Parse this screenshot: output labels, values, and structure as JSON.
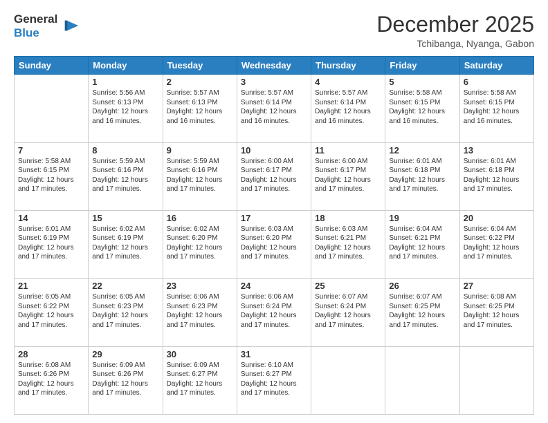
{
  "logo": {
    "general": "General",
    "blue": "Blue"
  },
  "header": {
    "month": "December 2025",
    "location": "Tchibanga, Nyanga, Gabon"
  },
  "weekdays": [
    "Sunday",
    "Monday",
    "Tuesday",
    "Wednesday",
    "Thursday",
    "Friday",
    "Saturday"
  ],
  "weeks": [
    [
      {
        "day": "",
        "sunrise": "",
        "sunset": "",
        "daylight": ""
      },
      {
        "day": "1",
        "sunrise": "Sunrise: 5:56 AM",
        "sunset": "Sunset: 6:13 PM",
        "daylight": "Daylight: 12 hours and 16 minutes."
      },
      {
        "day": "2",
        "sunrise": "Sunrise: 5:57 AM",
        "sunset": "Sunset: 6:13 PM",
        "daylight": "Daylight: 12 hours and 16 minutes."
      },
      {
        "day": "3",
        "sunrise": "Sunrise: 5:57 AM",
        "sunset": "Sunset: 6:14 PM",
        "daylight": "Daylight: 12 hours and 16 minutes."
      },
      {
        "day": "4",
        "sunrise": "Sunrise: 5:57 AM",
        "sunset": "Sunset: 6:14 PM",
        "daylight": "Daylight: 12 hours and 16 minutes."
      },
      {
        "day": "5",
        "sunrise": "Sunrise: 5:58 AM",
        "sunset": "Sunset: 6:15 PM",
        "daylight": "Daylight: 12 hours and 16 minutes."
      },
      {
        "day": "6",
        "sunrise": "Sunrise: 5:58 AM",
        "sunset": "Sunset: 6:15 PM",
        "daylight": "Daylight: 12 hours and 16 minutes."
      }
    ],
    [
      {
        "day": "7",
        "sunrise": "Sunrise: 5:58 AM",
        "sunset": "Sunset: 6:15 PM",
        "daylight": "Daylight: 12 hours and 17 minutes."
      },
      {
        "day": "8",
        "sunrise": "Sunrise: 5:59 AM",
        "sunset": "Sunset: 6:16 PM",
        "daylight": "Daylight: 12 hours and 17 minutes."
      },
      {
        "day": "9",
        "sunrise": "Sunrise: 5:59 AM",
        "sunset": "Sunset: 6:16 PM",
        "daylight": "Daylight: 12 hours and 17 minutes."
      },
      {
        "day": "10",
        "sunrise": "Sunrise: 6:00 AM",
        "sunset": "Sunset: 6:17 PM",
        "daylight": "Daylight: 12 hours and 17 minutes."
      },
      {
        "day": "11",
        "sunrise": "Sunrise: 6:00 AM",
        "sunset": "Sunset: 6:17 PM",
        "daylight": "Daylight: 12 hours and 17 minutes."
      },
      {
        "day": "12",
        "sunrise": "Sunrise: 6:01 AM",
        "sunset": "Sunset: 6:18 PM",
        "daylight": "Daylight: 12 hours and 17 minutes."
      },
      {
        "day": "13",
        "sunrise": "Sunrise: 6:01 AM",
        "sunset": "Sunset: 6:18 PM",
        "daylight": "Daylight: 12 hours and 17 minutes."
      }
    ],
    [
      {
        "day": "14",
        "sunrise": "Sunrise: 6:01 AM",
        "sunset": "Sunset: 6:19 PM",
        "daylight": "Daylight: 12 hours and 17 minutes."
      },
      {
        "day": "15",
        "sunrise": "Sunrise: 6:02 AM",
        "sunset": "Sunset: 6:19 PM",
        "daylight": "Daylight: 12 hours and 17 minutes."
      },
      {
        "day": "16",
        "sunrise": "Sunrise: 6:02 AM",
        "sunset": "Sunset: 6:20 PM",
        "daylight": "Daylight: 12 hours and 17 minutes."
      },
      {
        "day": "17",
        "sunrise": "Sunrise: 6:03 AM",
        "sunset": "Sunset: 6:20 PM",
        "daylight": "Daylight: 12 hours and 17 minutes."
      },
      {
        "day": "18",
        "sunrise": "Sunrise: 6:03 AM",
        "sunset": "Sunset: 6:21 PM",
        "daylight": "Daylight: 12 hours and 17 minutes."
      },
      {
        "day": "19",
        "sunrise": "Sunrise: 6:04 AM",
        "sunset": "Sunset: 6:21 PM",
        "daylight": "Daylight: 12 hours and 17 minutes."
      },
      {
        "day": "20",
        "sunrise": "Sunrise: 6:04 AM",
        "sunset": "Sunset: 6:22 PM",
        "daylight": "Daylight: 12 hours and 17 minutes."
      }
    ],
    [
      {
        "day": "21",
        "sunrise": "Sunrise: 6:05 AM",
        "sunset": "Sunset: 6:22 PM",
        "daylight": "Daylight: 12 hours and 17 minutes."
      },
      {
        "day": "22",
        "sunrise": "Sunrise: 6:05 AM",
        "sunset": "Sunset: 6:23 PM",
        "daylight": "Daylight: 12 hours and 17 minutes."
      },
      {
        "day": "23",
        "sunrise": "Sunrise: 6:06 AM",
        "sunset": "Sunset: 6:23 PM",
        "daylight": "Daylight: 12 hours and 17 minutes."
      },
      {
        "day": "24",
        "sunrise": "Sunrise: 6:06 AM",
        "sunset": "Sunset: 6:24 PM",
        "daylight": "Daylight: 12 hours and 17 minutes."
      },
      {
        "day": "25",
        "sunrise": "Sunrise: 6:07 AM",
        "sunset": "Sunset: 6:24 PM",
        "daylight": "Daylight: 12 hours and 17 minutes."
      },
      {
        "day": "26",
        "sunrise": "Sunrise: 6:07 AM",
        "sunset": "Sunset: 6:25 PM",
        "daylight": "Daylight: 12 hours and 17 minutes."
      },
      {
        "day": "27",
        "sunrise": "Sunrise: 6:08 AM",
        "sunset": "Sunset: 6:25 PM",
        "daylight": "Daylight: 12 hours and 17 minutes."
      }
    ],
    [
      {
        "day": "28",
        "sunrise": "Sunrise: 6:08 AM",
        "sunset": "Sunset: 6:26 PM",
        "daylight": "Daylight: 12 hours and 17 minutes."
      },
      {
        "day": "29",
        "sunrise": "Sunrise: 6:09 AM",
        "sunset": "Sunset: 6:26 PM",
        "daylight": "Daylight: 12 hours and 17 minutes."
      },
      {
        "day": "30",
        "sunrise": "Sunrise: 6:09 AM",
        "sunset": "Sunset: 6:27 PM",
        "daylight": "Daylight: 12 hours and 17 minutes."
      },
      {
        "day": "31",
        "sunrise": "Sunrise: 6:10 AM",
        "sunset": "Sunset: 6:27 PM",
        "daylight": "Daylight: 12 hours and 17 minutes."
      },
      {
        "day": "",
        "sunrise": "",
        "sunset": "",
        "daylight": ""
      },
      {
        "day": "",
        "sunrise": "",
        "sunset": "",
        "daylight": ""
      },
      {
        "day": "",
        "sunrise": "",
        "sunset": "",
        "daylight": ""
      }
    ]
  ]
}
